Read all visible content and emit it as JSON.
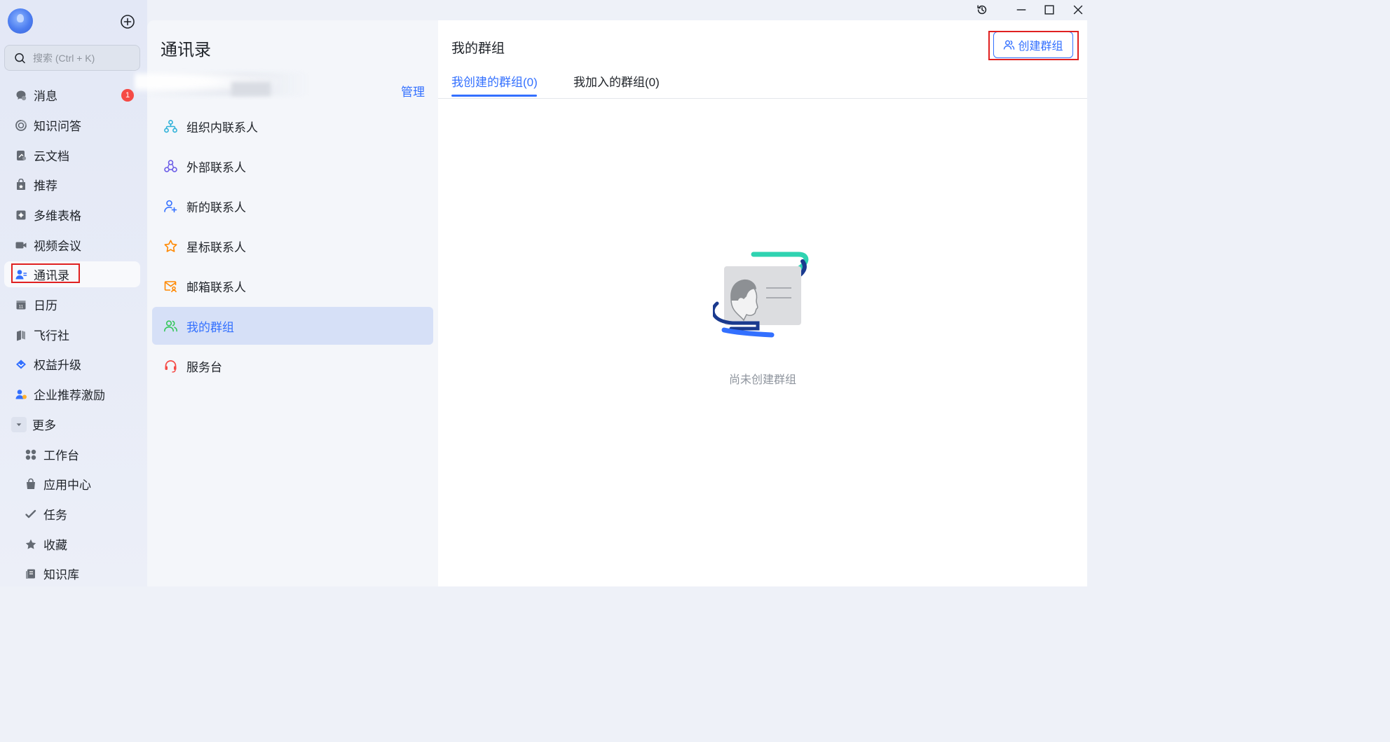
{
  "sidebar": {
    "search_placeholder": "搜索 (Ctrl + K)",
    "items": [
      {
        "label": "消息",
        "icon": "chat-bubble-icon",
        "badge": "1"
      },
      {
        "label": "知识问答",
        "icon": "ai-spark-icon"
      },
      {
        "label": "云文档",
        "icon": "cloud-doc-icon"
      },
      {
        "label": "推荐",
        "icon": "recommend-icon"
      },
      {
        "label": "多维表格",
        "icon": "base-table-icon"
      },
      {
        "label": "视频会议",
        "icon": "video-camera-icon"
      },
      {
        "label": "通讯录",
        "icon": "contacts-icon"
      },
      {
        "label": "日历",
        "icon": "calendar-icon"
      },
      {
        "label": "飞行社",
        "icon": "flight-club-icon"
      },
      {
        "label": "权益升级",
        "icon": "diamond-icon"
      },
      {
        "label": "企业推荐激励",
        "icon": "referral-icon"
      },
      {
        "label": "更多",
        "icon": "chevron-down-icon"
      },
      {
        "label": "工作台",
        "icon": "workspace-icon"
      },
      {
        "label": "应用中心",
        "icon": "app-center-icon"
      },
      {
        "label": "任务",
        "icon": "task-icon"
      },
      {
        "label": "收藏",
        "icon": "star-icon"
      },
      {
        "label": "知识库",
        "icon": "wiki-icon"
      }
    ],
    "active": "通讯录"
  },
  "contacts": {
    "title": "通讯录",
    "manage_label": "管理",
    "items": [
      {
        "label": "组织内联系人",
        "icon": "org-tree-icon",
        "color": "#2eb1d8"
      },
      {
        "label": "外部联系人",
        "icon": "external-contacts-icon",
        "color": "#6b5ce7"
      },
      {
        "label": "新的联系人",
        "icon": "add-contact-icon",
        "color": "#3370ff"
      },
      {
        "label": "星标联系人",
        "icon": "star-outline-icon",
        "color": "#ff8800"
      },
      {
        "label": "邮箱联系人",
        "icon": "mail-contact-icon",
        "color": "#ff8800"
      },
      {
        "label": "我的群组",
        "icon": "group-icon",
        "color": "#34c759"
      },
      {
        "label": "服务台",
        "icon": "headset-icon",
        "color": "#f54a45"
      }
    ],
    "active": "我的群组"
  },
  "main": {
    "title": "我的群组",
    "create_button": "创建群组",
    "tabs": [
      {
        "label": "我创建的群组(0)"
      },
      {
        "label": "我加入的群组(0)"
      }
    ],
    "active_tab": 0,
    "empty_text": "尚未创建群组"
  },
  "colors": {
    "accent": "#3370ff",
    "badge": "#f54a45",
    "highlight_box": "#e02020"
  }
}
